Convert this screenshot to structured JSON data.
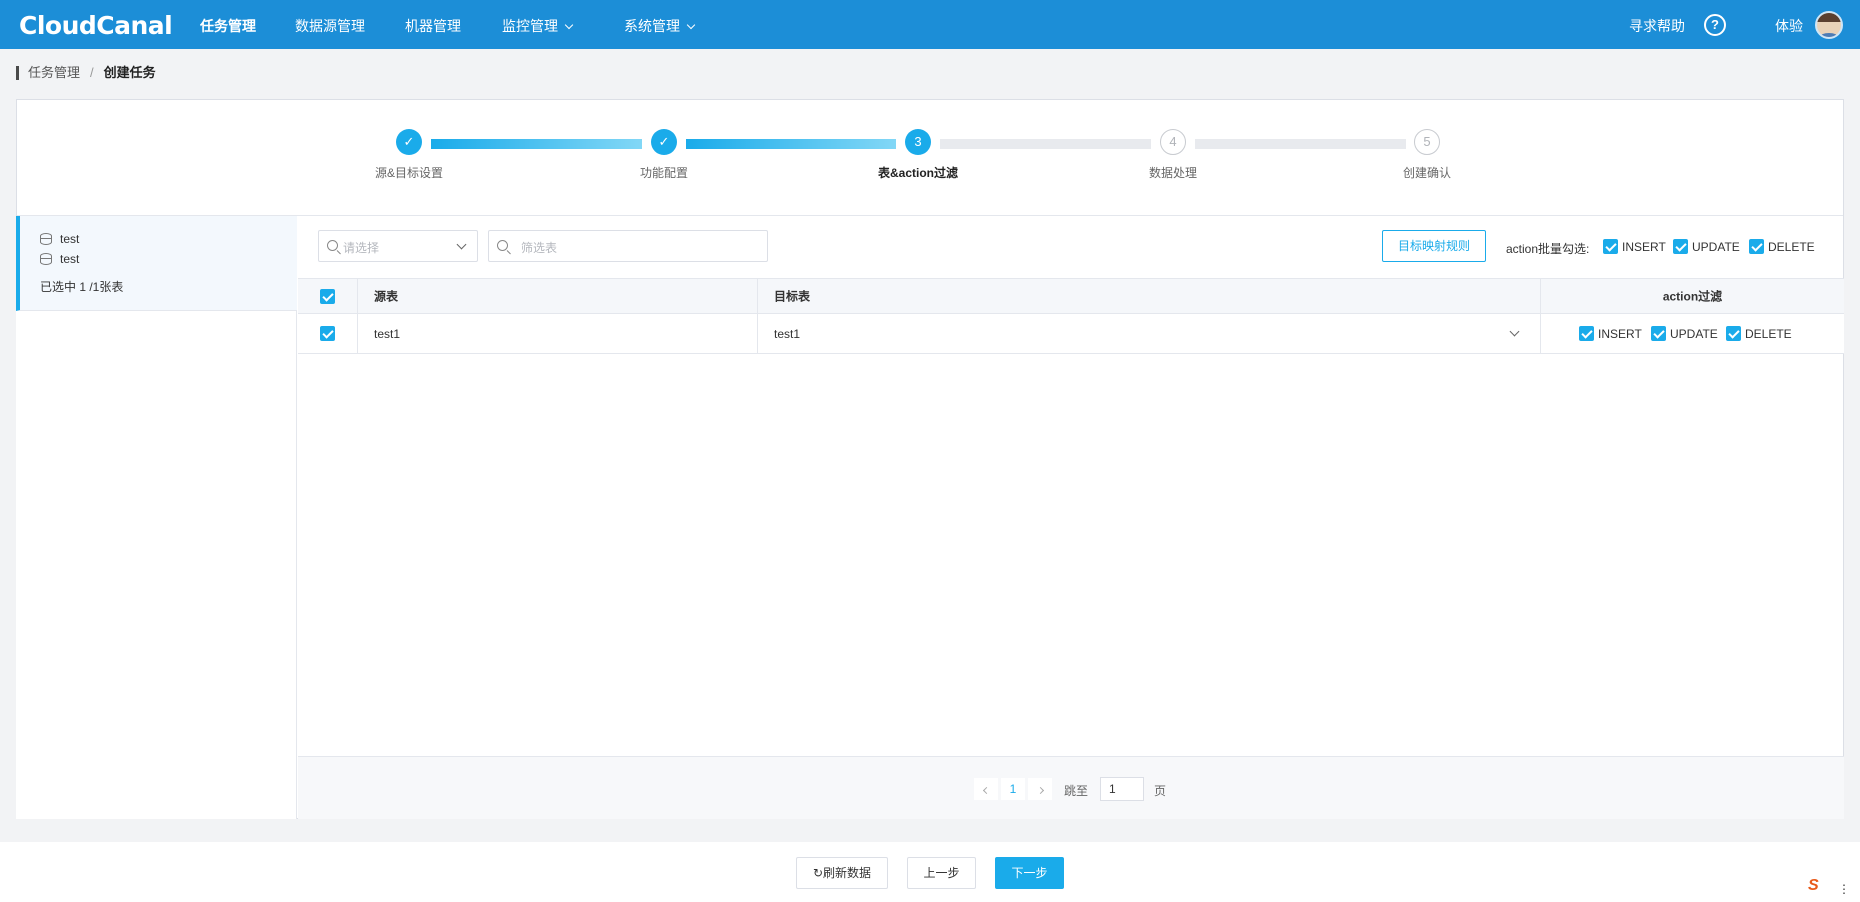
{
  "header": {
    "logo": "CloudCanal",
    "nav": [
      {
        "label": "任务管理",
        "active": true
      },
      {
        "label": "数据源管理"
      },
      {
        "label": "机器管理"
      },
      {
        "label": "监控管理",
        "dropdown": true
      },
      {
        "label": "系统管理",
        "dropdown": true
      }
    ],
    "help_label": "寻求帮助",
    "help_icon": "?",
    "user_label": "体验"
  },
  "breadcrumb": {
    "parent": "任务管理",
    "separator": "/",
    "current": "创建任务"
  },
  "steps": [
    {
      "number": "1",
      "label": "源&目标设置",
      "state": "done"
    },
    {
      "number": "2",
      "label": "功能配置",
      "state": "done"
    },
    {
      "number": "3",
      "label": "表&action过滤",
      "state": "current"
    },
    {
      "number": "4",
      "label": "数据处理",
      "state": "todo"
    },
    {
      "number": "5",
      "label": "创建确认",
      "state": "todo"
    }
  ],
  "left_panel": {
    "databases": [
      "test",
      "test"
    ],
    "summary": "已选中 1 /1张表"
  },
  "toolbar": {
    "select_placeholder": "请选择",
    "filter_placeholder": "筛选表",
    "mapping_button": "目标映射规则",
    "batch_label": "action批量勾选:",
    "batch_actions": [
      "INSERT",
      "UPDATE",
      "DELETE"
    ]
  },
  "table": {
    "headers": {
      "source": "源表",
      "target": "目标表",
      "action": "action过滤"
    },
    "rows": [
      {
        "source": "test1",
        "target": "test1",
        "actions": [
          "INSERT",
          "UPDATE",
          "DELETE"
        ]
      }
    ]
  },
  "pagination": {
    "current": "1",
    "jump_label": "跳至",
    "jump_value": "1",
    "page_label": "页"
  },
  "footer": {
    "refresh": "刷新数据",
    "prev": "上一步",
    "next": "下一步"
  },
  "colors": {
    "primary": "#1aabea",
    "header": "#1c8ed7"
  }
}
